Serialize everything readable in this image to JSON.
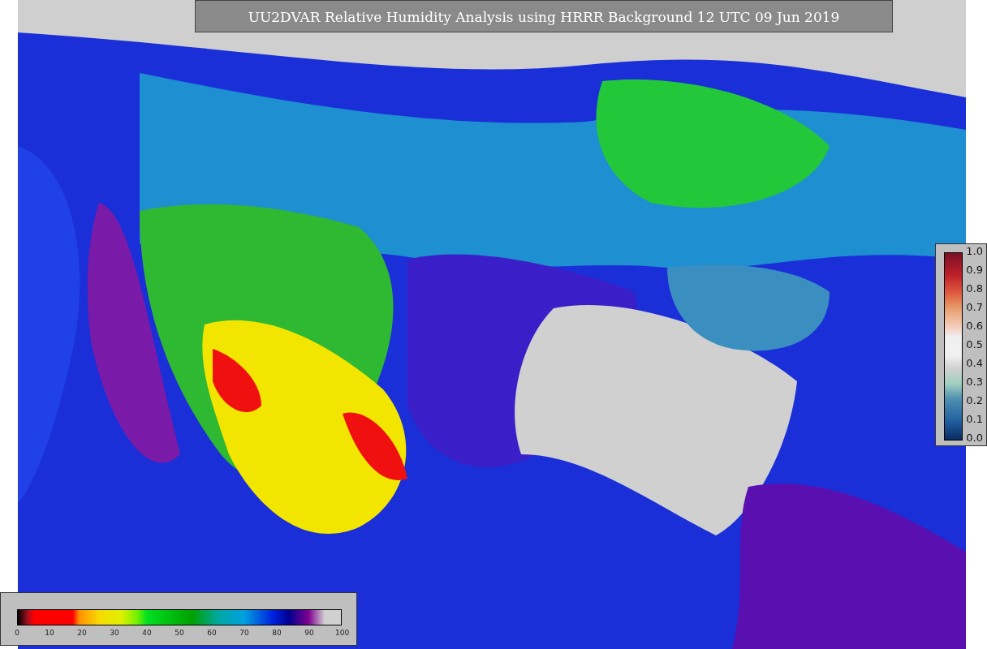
{
  "title": "UU2DVAR Relative Humidity Analysis using HRRR Background 12 UTC 09 Jun 2019",
  "humidity_colorbar": {
    "ticks": [
      "0",
      "10",
      "20",
      "30",
      "40",
      "50",
      "60",
      "70",
      "80",
      "90",
      "100"
    ]
  },
  "observation_colorbar": {
    "ticks": [
      "1.0",
      "0.9",
      "0.8",
      "0.7",
      "0.6",
      "0.5",
      "0.4",
      "0.3",
      "0.2",
      "0.1",
      "0.0"
    ]
  }
}
